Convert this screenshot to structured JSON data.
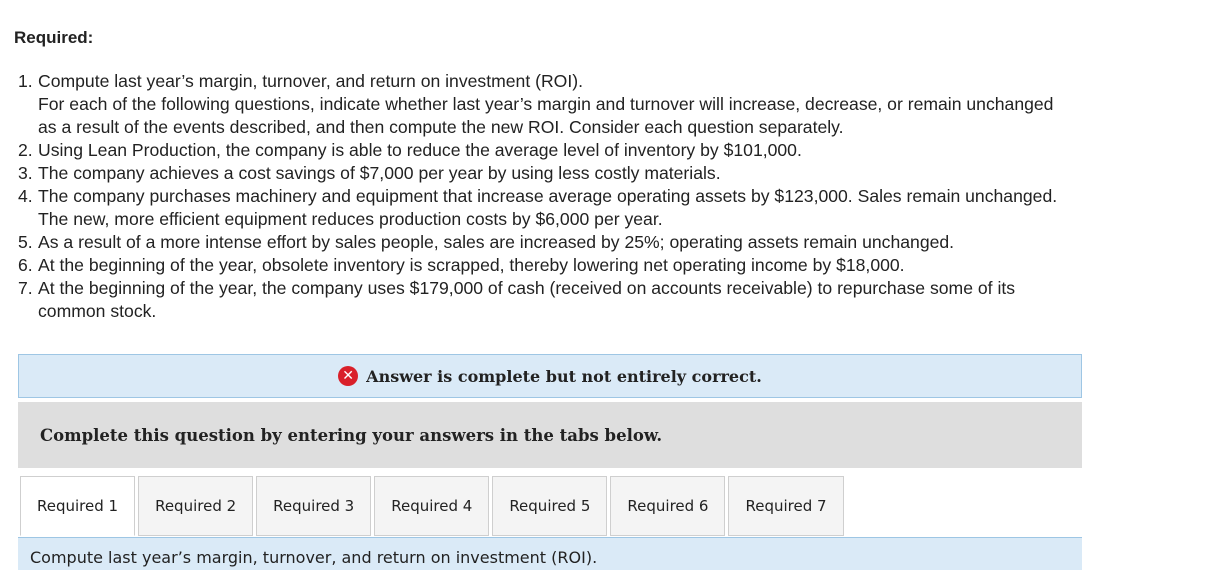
{
  "heading": "Required:",
  "questions": [
    {
      "num": "1.",
      "lines": [
        "Compute last year’s margin, turnover, and return on investment (ROI).",
        "For each of the following questions, indicate whether last year’s margin and turnover will increase, decrease, or remain unchanged",
        "as a result of the events described, and then compute the new ROI. Consider each question separately."
      ]
    },
    {
      "num": "2.",
      "lines": [
        "Using Lean Production, the company is able to reduce the average level of inventory by $101,000."
      ]
    },
    {
      "num": "3.",
      "lines": [
        "The company achieves a cost savings of $7,000 per year by using less costly materials."
      ]
    },
    {
      "num": "4.",
      "lines": [
        "The company purchases machinery and equipment that increase average operating assets by $123,000. Sales remain unchanged.",
        "The new, more efficient equipment reduces production costs by $6,000 per year."
      ]
    },
    {
      "num": "5.",
      "lines": [
        "As a result of a more intense effort by sales people, sales are increased by 25%; operating assets remain unchanged."
      ]
    },
    {
      "num": "6.",
      "lines": [
        "At the beginning of the year, obsolete inventory is scrapped, thereby lowering net operating income by $18,000."
      ]
    },
    {
      "num": "7.",
      "lines": [
        "At the beginning of the year, the company uses $179,000 of cash (received on accounts receivable) to repurchase some of its",
        "common stock."
      ]
    }
  ],
  "feedback": {
    "icon": "x-circle-icon",
    "text": "Answer is complete but not entirely correct."
  },
  "instructions": "Complete this question by entering your answers in the tabs below.",
  "tabs": [
    "Required 1",
    "Required 2",
    "Required 3",
    "Required 4",
    "Required 5",
    "Required 6",
    "Required 7"
  ],
  "active_tab": "Required 1",
  "tab_panel_text": "Compute last year’s margin, turnover, and return on investment (ROI).",
  "colors": {
    "banner_bg": "#daeaf7",
    "error_red": "#d9202a",
    "instructions_bg": "#dedede"
  }
}
